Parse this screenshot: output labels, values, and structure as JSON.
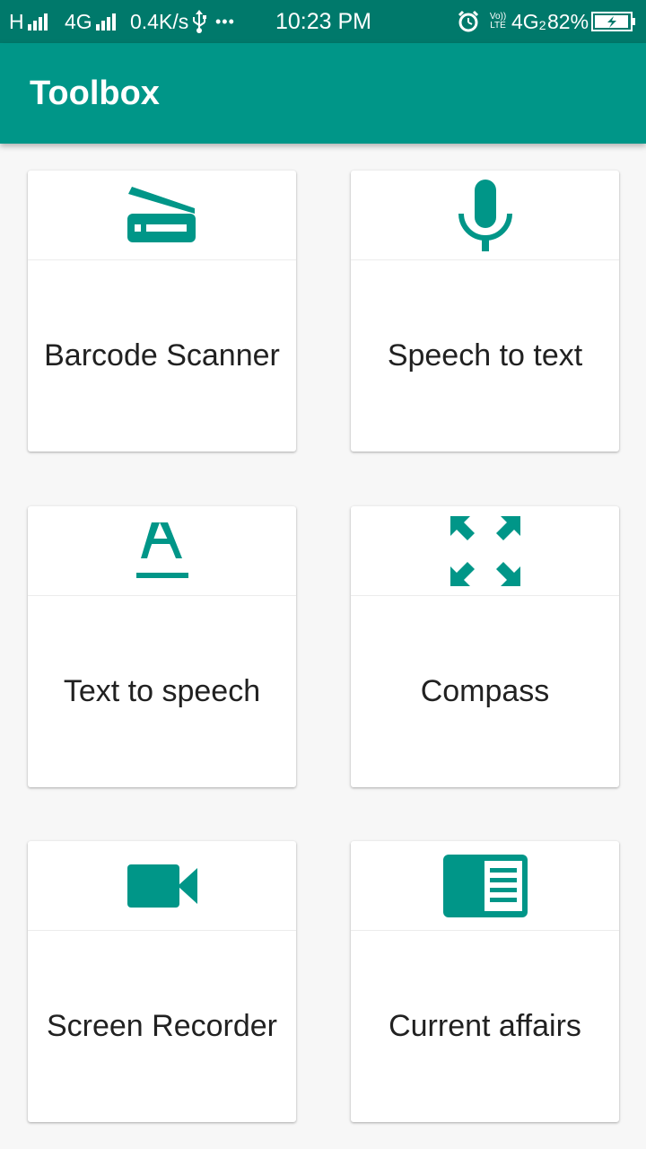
{
  "status_bar": {
    "network_type_1": "H",
    "network_type_2": "4G",
    "speed": "0.4K/s",
    "more": "•••",
    "time": "10:23 PM",
    "volte": "Vo)) LTE",
    "network_type_3": "4G",
    "sim_slot": "2",
    "battery_percent": "82%",
    "icons": [
      "signal-icon",
      "usb-icon",
      "alarm-icon",
      "battery-charging-icon"
    ]
  },
  "app_bar": {
    "title": "Toolbox"
  },
  "accent_color": "#009688",
  "tools": [
    {
      "label": "Barcode Scanner",
      "icon": "scanner-icon"
    },
    {
      "label": "Speech to text",
      "icon": "microphone-icon"
    },
    {
      "label": "Text to speech",
      "icon": "text-format-icon"
    },
    {
      "label": "Compass",
      "icon": "fullscreen-arrows-icon"
    },
    {
      "label": "Screen Recorder",
      "icon": "videocam-icon"
    },
    {
      "label": "Current affairs",
      "icon": "chrome-reader-icon"
    }
  ]
}
